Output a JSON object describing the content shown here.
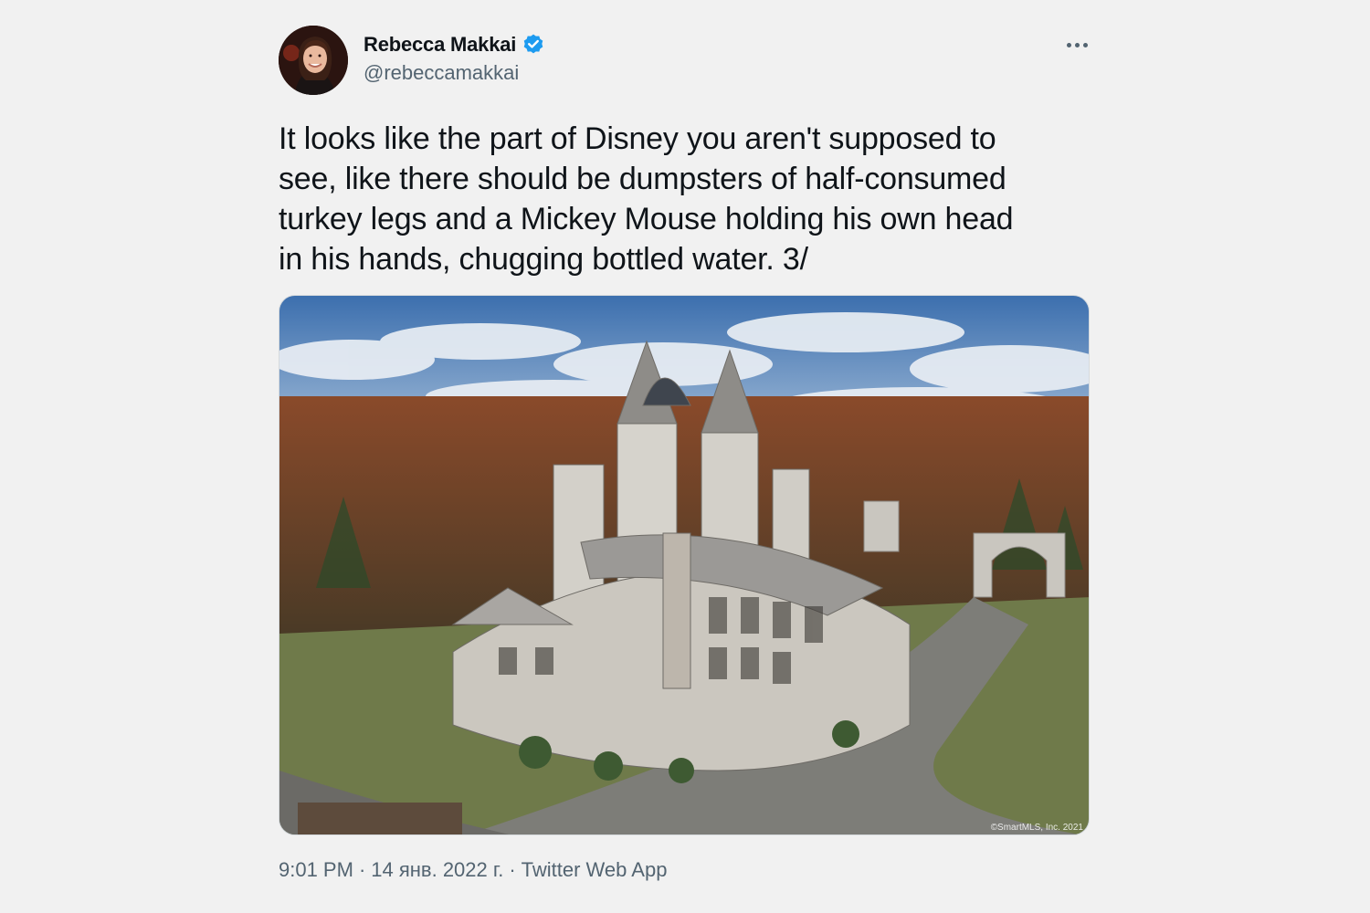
{
  "author": {
    "display_name": "Rebecca Makkai",
    "handle": "@rebeccamakkai",
    "verified_icon": "verified-badge-icon",
    "avatar_icon": "avatar"
  },
  "tweet": {
    "text": "It looks like the part of Disney you aren't supposed to\nsee, like there should be dumpsters of half-consumed\nturkey legs and a Mickey Mouse holding his own head\nin his hands, chugging bottled water. 3/",
    "media_watermark": "©SmartMLS, Inc. 2021"
  },
  "meta": {
    "time": "9:01 PM",
    "separator": "·",
    "date": "14 янв. 2022 г.",
    "source": "Twitter Web App"
  },
  "colors": {
    "background": "#f1f1f1",
    "text": "#0f1419",
    "secondary": "#536471",
    "verified": "#1d9bf0"
  }
}
